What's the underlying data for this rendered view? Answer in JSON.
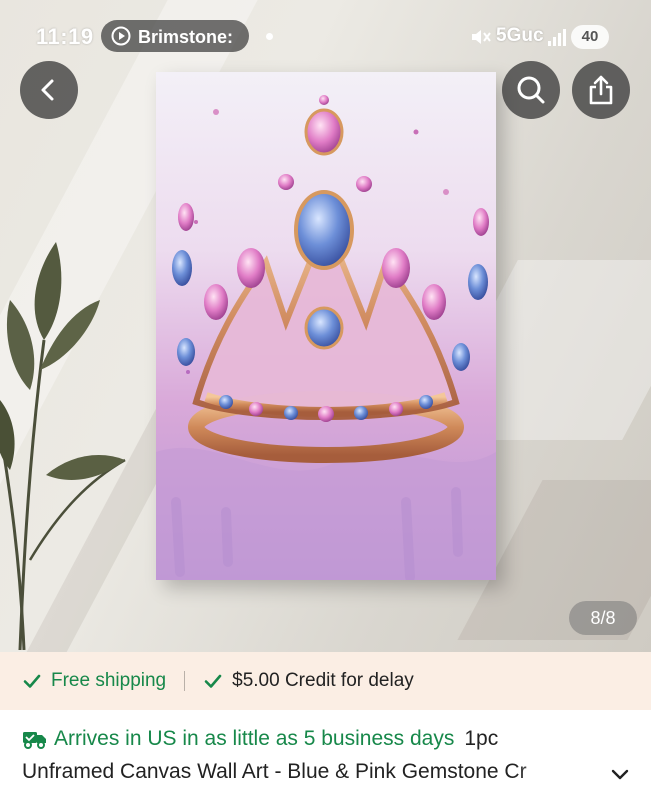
{
  "status_bar": {
    "time": "11:19",
    "media_label": "Brimstone:",
    "network": "5Guc",
    "battery": "40"
  },
  "gallery": {
    "counter": "8/8",
    "icons": [
      "back-arrow-icon",
      "search-icon",
      "share-icon",
      "play-circle-icon",
      "mute-icon",
      "signal-icon"
    ]
  },
  "shipping": {
    "free_label": "Free shipping",
    "credit_label": "$5.00 Credit for delay"
  },
  "product": {
    "arrives_label": "Arrives in US in as little as 5 business days",
    "quantity_label": "1pc",
    "title": "Unframed Canvas Wall Art - Blue & Pink Gemstone Cr"
  },
  "colors": {
    "green": "#17884a",
    "shipping_band": "#fbeee4"
  }
}
